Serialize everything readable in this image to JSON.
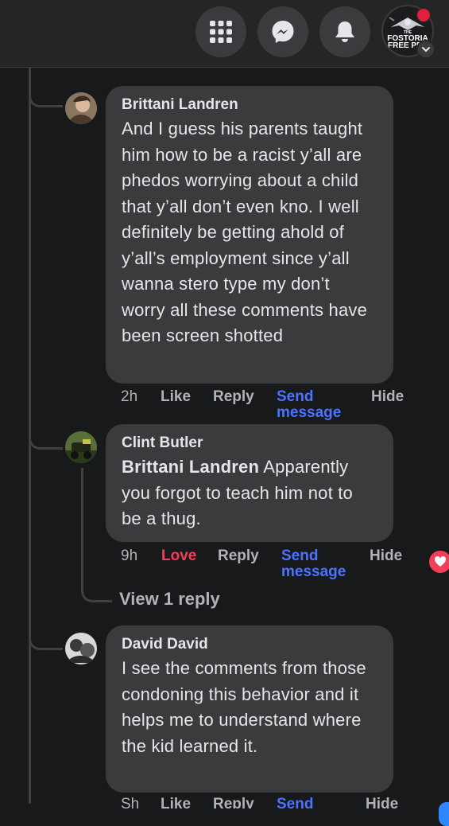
{
  "topbar": {
    "menu_icon": "grid-menu-icon",
    "messenger_icon": "messenger-icon",
    "notifications_icon": "bell-icon",
    "profile": {
      "line1": "THE",
      "line2": "FOSTORIA",
      "line3": "FREE PRE"
    }
  },
  "comments": [
    {
      "author": "Brittani Landren",
      "text": "And I guess his parents taught him how to be a racist y’all are phedos worrying about a child that y’all don’t even kno. I well definitely be getting ahold of y’all’s employment since y’all wanna stero type my don’t worry all these comments have been screen shotted",
      "time": "2h",
      "like": "Like",
      "reply": "Reply",
      "send1": "Send",
      "send2": "message",
      "hide": "Hide"
    },
    {
      "author": "Clint Butler",
      "mention": "Brittani Landren",
      "text": " Apparently you forgot to teach him not to be a thug.",
      "time": "9h",
      "like": "Love",
      "reply": "Reply",
      "send1": "Send",
      "send2": "message",
      "hide": "Hide",
      "view_replies": "View 1 reply"
    },
    {
      "author": "David David",
      "text": "I see the comments from those condoning this behavior and it helps me to understand where the kid learned it.",
      "time": "Sh",
      "like": "Like",
      "reply": "Reply",
      "send1": "Send",
      "hide": "Hide"
    }
  ],
  "colors": {
    "background": "#18191a",
    "bubble": "#3a3b3c",
    "link_blue": "#4b73ff",
    "love_red": "#f33e58"
  }
}
